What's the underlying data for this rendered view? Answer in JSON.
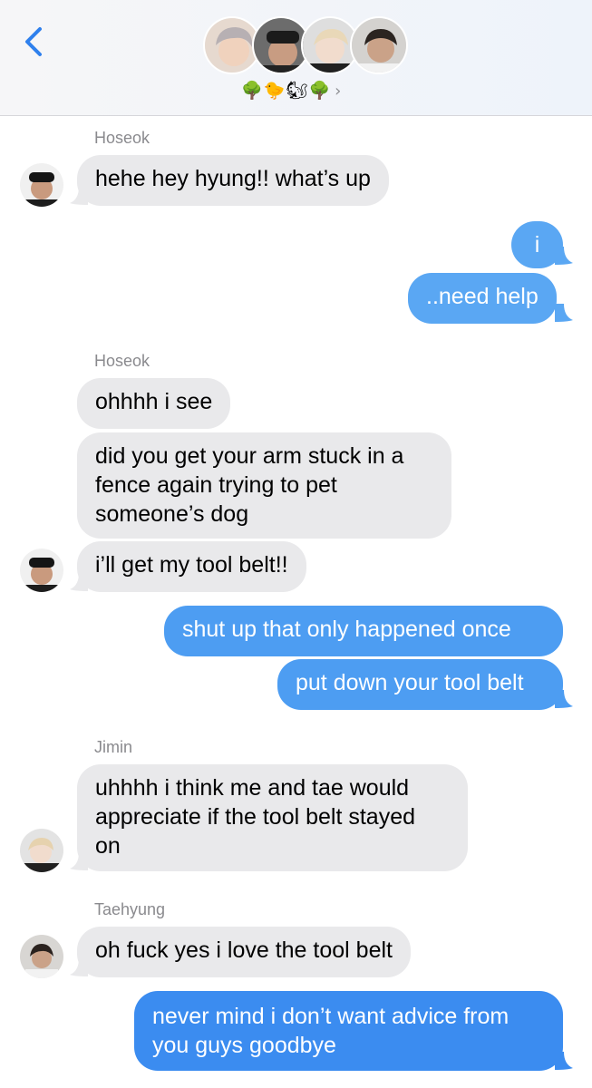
{
  "header": {
    "back_icon": "chevron-left-icon",
    "group_avatars": [
      "avatar-1",
      "avatar-2",
      "avatar-3",
      "avatar-4"
    ],
    "emojis": [
      "🌳",
      "🐤",
      "🐿",
      "🌳"
    ],
    "chevron": "›"
  },
  "colors": {
    "sent_bubble": "#5aa7f3",
    "sent_bubble_dark": "#3b8cf0",
    "received_bubble": "#e9e9eb",
    "back_icon": "#2f80ed"
  },
  "messages": {
    "s1": "Hoseok",
    "m1": "hehe hey hyung!! what’s up",
    "m2": "i",
    "m3": "..need help",
    "s2": "Hoseok",
    "m4": "ohhhh i see",
    "m5_l1": "did you get your arm stuck in a",
    "m5_l2": "fence again trying to pet",
    "m5_l3": "someone’s dog",
    "m6": "i’ll get my tool belt!!",
    "m7": "shut up that only happened once",
    "m8": "put down your tool belt",
    "s3": "Jimin",
    "m9_l1": "uhhhh i think me and tae would",
    "m9_l2": "appreciate if the tool belt stayed",
    "m9_l3": "on",
    "s4": "Taehyung",
    "m10": "oh fuck yes i love the tool belt",
    "m11_l1": "never mind i don’t want advice from",
    "m11_l2": "you guys goodbye"
  }
}
